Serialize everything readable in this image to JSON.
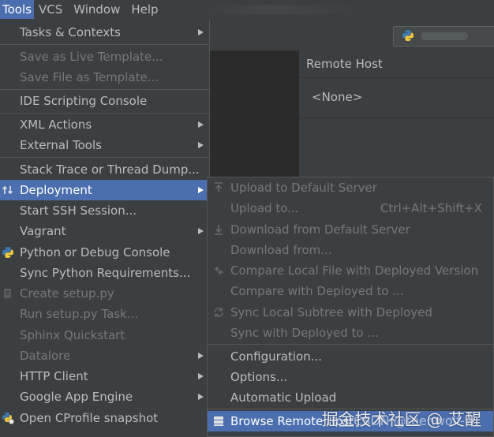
{
  "menubar": {
    "items": [
      {
        "label": "Tools"
      },
      {
        "label": "VCS"
      },
      {
        "label": "Window"
      },
      {
        "label": "Help"
      }
    ]
  },
  "remote_host": {
    "header": "Remote Host",
    "value": "<None>"
  },
  "tools_menu": {
    "items": [
      {
        "label": "Tasks & Contexts"
      },
      {
        "label": "Save as Live Template..."
      },
      {
        "label": "Save File as Template..."
      },
      {
        "label": "IDE Scripting Console"
      },
      {
        "label": "XML Actions"
      },
      {
        "label": "External Tools"
      },
      {
        "label": "Stack Trace or Thread Dump..."
      },
      {
        "label": "Deployment"
      },
      {
        "label": "Start SSH Session..."
      },
      {
        "label": "Vagrant"
      },
      {
        "label": "Python or Debug Console"
      },
      {
        "label": "Sync Python Requirements..."
      },
      {
        "label": "Create setup.py"
      },
      {
        "label": "Run setup.py Task..."
      },
      {
        "label": "Sphinx Quickstart"
      },
      {
        "label": "Datalore"
      },
      {
        "label": "HTTP Client"
      },
      {
        "label": "Google App Engine"
      },
      {
        "label": "Open CProfile snapshot"
      }
    ]
  },
  "deployment_menu": {
    "items": [
      {
        "label": "Upload to Default Server"
      },
      {
        "label": "Upload to...",
        "shortcut": "Ctrl+Alt+Shift+X"
      },
      {
        "label": "Download from Default Server"
      },
      {
        "label": "Download from..."
      },
      {
        "label": "Compare Local File with Deployed Version"
      },
      {
        "label": "Compare with Deployed to ..."
      },
      {
        "label": "Sync Local Subtree with Deployed"
      },
      {
        "label": "Sync with Deployed to ..."
      },
      {
        "label": "Configuration..."
      },
      {
        "label": "Options..."
      },
      {
        "label": "Automatic Upload"
      },
      {
        "label": "Browse Remote Host"
      }
    ]
  },
  "watermark": {
    "text": "掘金技术社区 @ 艾醒",
    "sub": "CSDN @teenwolf-w"
  },
  "colors": {
    "menu_bg": "#3c3f41",
    "selection": "#4b6eaf",
    "text": "#bbbbbb",
    "disabled_text": "#777777",
    "editor_bg": "#2b2b2b"
  }
}
